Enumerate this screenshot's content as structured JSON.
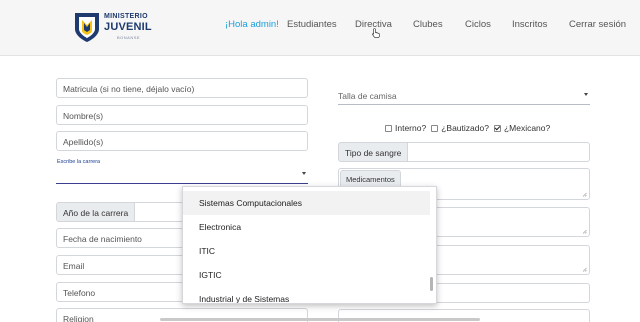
{
  "navbar": {
    "logo": {
      "line1": "MINISTERIO",
      "line2": "JUVENIL",
      "line3": "BONANSE"
    },
    "items": [
      {
        "label": "¡Hola admin!"
      },
      {
        "label": "Estudiantes"
      },
      {
        "label": "Directiva"
      },
      {
        "label": "Clubes"
      },
      {
        "label": "Ciclos"
      },
      {
        "label": "Inscritos"
      },
      {
        "label": "Cerrar sesión"
      }
    ]
  },
  "form": {
    "left": {
      "matricula_placeholder": "Matricula (si no tiene, déjalo vacío)",
      "nombre_placeholder": "Nombre(s)",
      "apellido_placeholder": "Apellido(s)",
      "carrera_label": "Escribe la carrera",
      "carrera_value": "",
      "anio_label": "Año de la carrera",
      "fecha_placeholder": "Fecha de nacimiento",
      "email_placeholder": "Email",
      "telefono_placeholder": "Telefono",
      "religion_placeholder": "Religion"
    },
    "right": {
      "talla_placeholder": "Talla de camisa",
      "checkboxes": [
        {
          "label": "Interno?",
          "checked": false
        },
        {
          "label": "¿Bautizado?",
          "checked": false
        },
        {
          "label": "¿Mexicano?",
          "checked": true
        }
      ],
      "sangre_label": "Tipo de sangre",
      "medicamentos_label": "Medicamentos"
    }
  },
  "dropdown": {
    "options": [
      {
        "label": "Sistemas Computacionales",
        "highlighted": true
      },
      {
        "label": "Electronica",
        "highlighted": false
      },
      {
        "label": "ITIC",
        "highlighted": false
      },
      {
        "label": "IGTIC",
        "highlighted": false
      },
      {
        "label": "Industrial y de Sistemas",
        "highlighted": false
      }
    ]
  },
  "colors": {
    "accent": "#1aa0d9",
    "logo_blue": "#1f3a6e",
    "logo_yellow": "#f5c218",
    "label_blue": "#1a3f8f"
  },
  "icons": {
    "cursor": "hand-pointer-icon",
    "caret": "caret-down-icon"
  }
}
